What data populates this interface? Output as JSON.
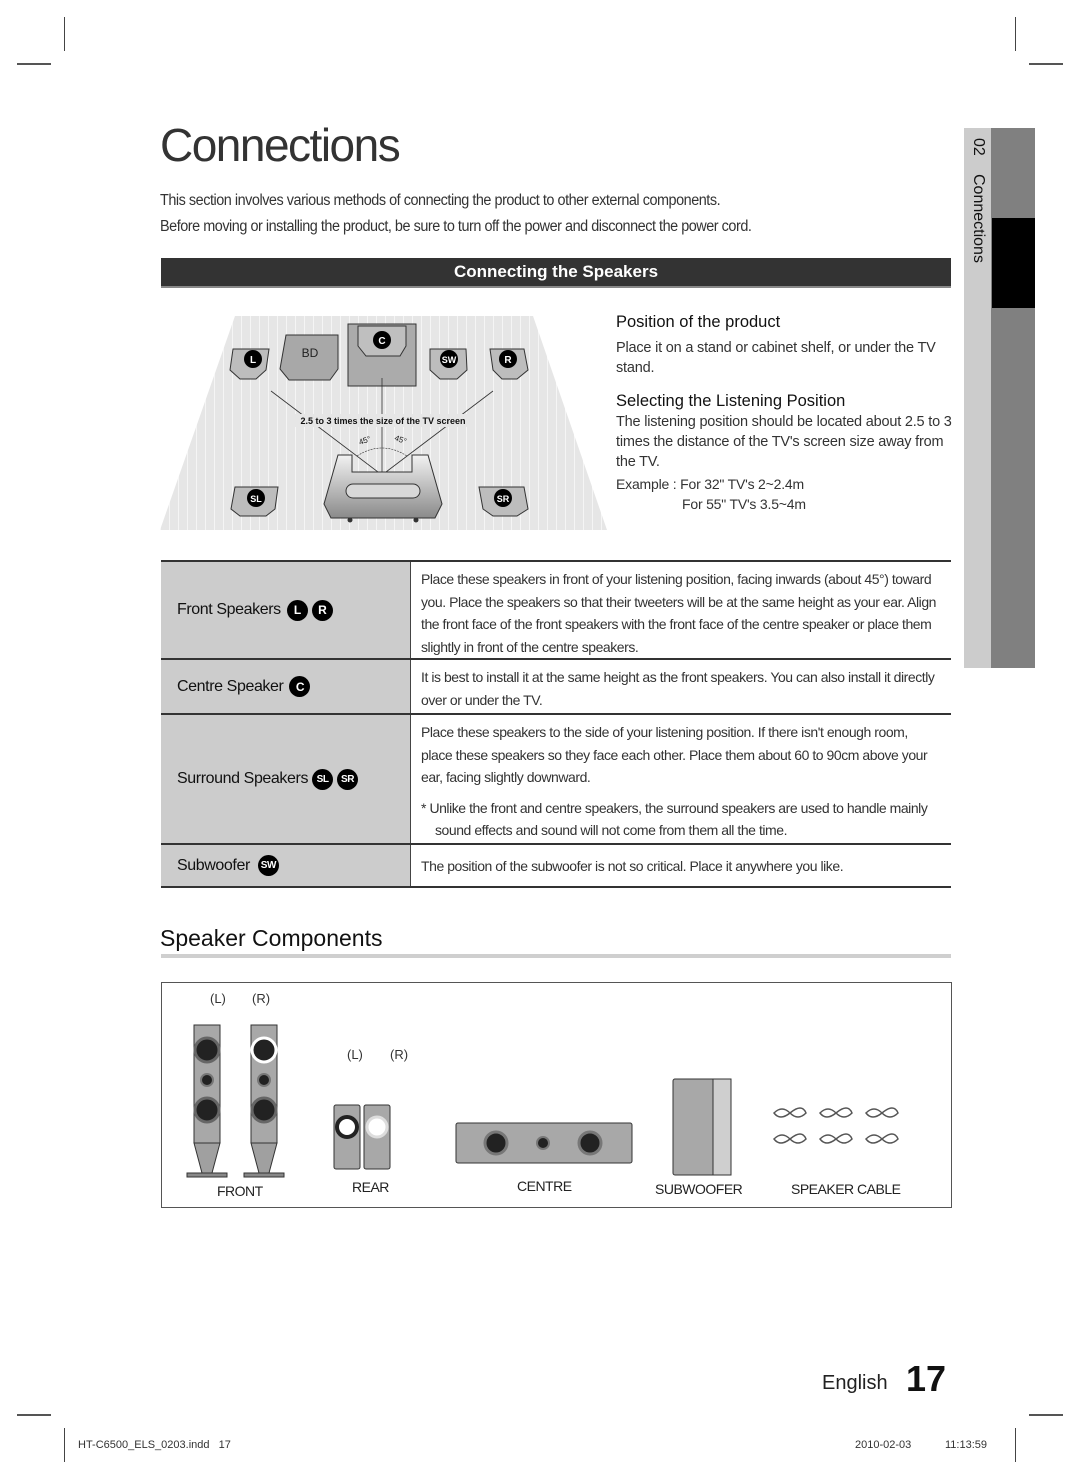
{
  "page": {
    "title": "Connections",
    "intro": [
      "This section involves various methods of connecting the product to other external components.",
      "Before moving or installing the product, be sure to turn off the power and disconnect the power cord."
    ],
    "section_bar": "Connecting the Speakers"
  },
  "side_tab": {
    "number": "02",
    "label": "Connections"
  },
  "diagram": {
    "speakers": [
      "L",
      "R",
      "C",
      "SW",
      "SL",
      "SR"
    ],
    "device_label": "BD",
    "distance_label": "2.5 to 3 times the size of the TV screen",
    "angle_left": "45°",
    "angle_right": "45°"
  },
  "right_panel": {
    "position_heading": "Position of the product",
    "position_text": "Place it on a stand or cabinet shelf, or under the TV stand.",
    "listening_heading": "Selecting the Listening Position",
    "listening_text": "The listening position should be located about 2.5 to 3 times the distance of the TV's screen size away from the TV.",
    "example_1": "Example : For 32\" TV's 2~2.4m",
    "example_2": "For 55\" TV's 3.5~4m"
  },
  "table": {
    "rows": [
      {
        "label": "Front Speakers",
        "badges": [
          "L",
          "R"
        ],
        "text": "Place these speakers in front of your listening position, facing inwards (about 45°) toward you. Place the speakers so that their tweeters will be at the same height as your ear. Align the front face of the front speakers with the front face of the centre speaker or place them slightly in front of the centre speakers."
      },
      {
        "label": "Centre Speaker",
        "badges": [
          "C"
        ],
        "text": "It is best to install it at the same height as the front speakers. You can also install it directly over or under the TV."
      },
      {
        "label": "Surround Speakers",
        "badges": [
          "SL",
          "SR"
        ],
        "text": "Place these speakers to the side of your listening position. If there isn't enough room, place these speakers so they face each other. Place them about 60 to 90cm above your ear, facing slightly downward.",
        "note": "* Unlike the front and centre speakers, the surround speakers are used to handle mainly sound effects and sound will not come from them all the time."
      },
      {
        "label": "Subwoofer",
        "badges": [
          "SW"
        ],
        "text": "The position of the subwoofer is not so critical. Place it anywhere you like."
      }
    ]
  },
  "components": {
    "title": "Speaker Components",
    "front_lr": [
      "(L)",
      "(R)"
    ],
    "rear_lr": [
      "(L)",
      "(R)"
    ],
    "labels": {
      "front": "FRONT",
      "rear": "REAR",
      "centre": "CENTRE",
      "subwoofer": "SUBWOOFER",
      "cable": "SPEAKER CABLE"
    }
  },
  "footer": {
    "language": "English",
    "page_number": "17",
    "file": "HT-C6500_ELS_0203.indd   17",
    "date": "2010-02-03",
    "time": "11:13:59"
  }
}
